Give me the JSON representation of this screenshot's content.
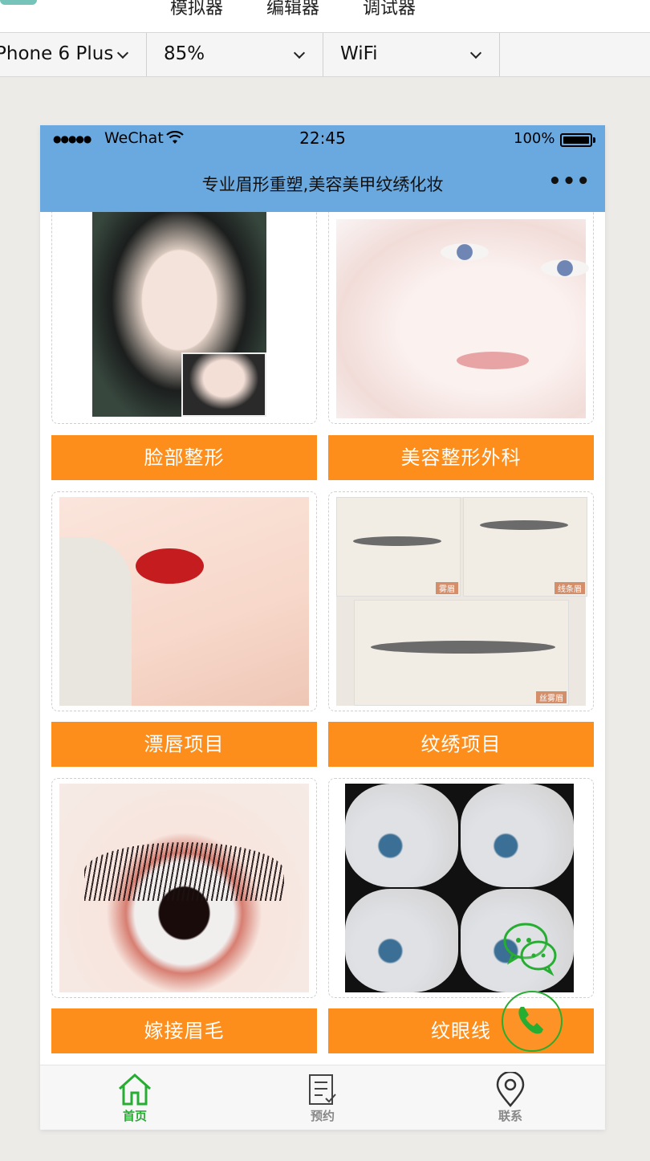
{
  "devtools": {
    "tabs": [
      "模拟器",
      "编辑器",
      "调试器"
    ],
    "device": "Phone 6 Plus",
    "zoom": "85%",
    "network": "WiFi"
  },
  "status_bar": {
    "signal": "●●●●●",
    "carrier": "WeChat",
    "time": "22:45",
    "battery": "100%"
  },
  "nav": {
    "title": "专业眉形重塑,美容美甲纹绣化妆",
    "more": "•••"
  },
  "cards": [
    {
      "label": "脸部整形",
      "image": "face-portrait-image"
    },
    {
      "label": "美容整形外科",
      "image": "face-closeup-image"
    },
    {
      "label": "漂唇项目",
      "image": "lip-tattoo-image"
    },
    {
      "label": "纹绣项目",
      "image": "eyebrow-tattoo-image"
    },
    {
      "label": "嫁接眉毛",
      "image": "eyelash-image"
    },
    {
      "label": "纹眼线",
      "image": "eyeliner-image"
    }
  ],
  "floating": {
    "wechat_icon": "wechat-chat-icon",
    "phone_icon": "phone-call-icon"
  },
  "tabbar": {
    "items": [
      {
        "label": "首页",
        "icon": "home-icon",
        "active": true
      },
      {
        "label": "预约",
        "icon": "booking-icon",
        "active": false
      },
      {
        "label": "联系",
        "icon": "location-pin-icon",
        "active": false
      }
    ]
  },
  "colors": {
    "nav_bg": "#6aa9e0",
    "label_bg": "#fd8e1b",
    "active_tab": "#27ad32",
    "inactive_tab": "#888888"
  }
}
